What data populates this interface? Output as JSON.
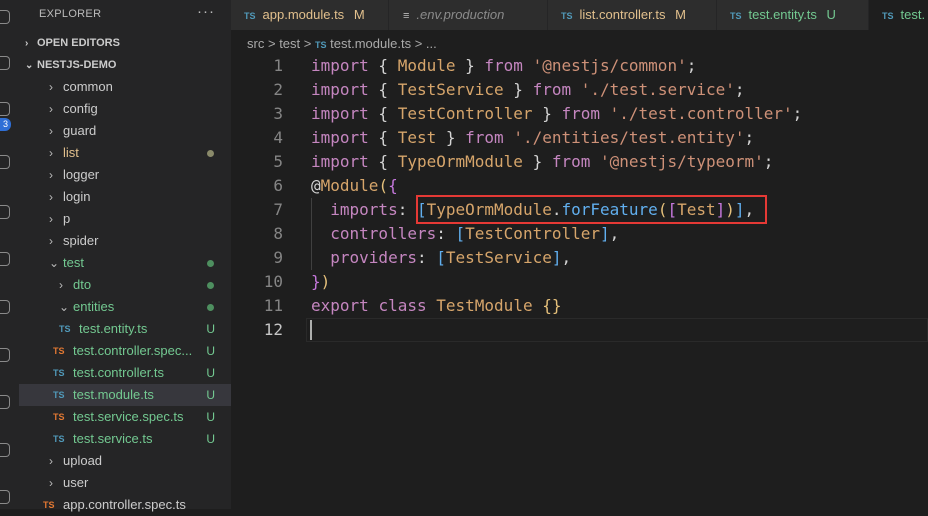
{
  "colors": {
    "ts_blue": "#519aba",
    "ts_orange": "#e37933",
    "untracked_green": "#73c991",
    "modified_yellow": "#e2c08d",
    "modified_dot": "#8a8a6a",
    "highlight_red": "#e53935"
  },
  "activity_bar": {
    "badge_count": "3",
    "icons": [
      "files-icon",
      "search-icon",
      "source-control-icon",
      "run-debug-icon",
      "extensions-icon",
      "remote-icon",
      "docker-icon",
      "accounts-icon"
    ]
  },
  "explorer": {
    "title": "EXPLORER",
    "more": "···",
    "open_editors": "OPEN EDITORS",
    "project": "NESTJS-DEMO",
    "tree": [
      {
        "label": "common",
        "kind": "folder",
        "depth": 1,
        "status": ""
      },
      {
        "label": "config",
        "kind": "folder",
        "depth": 1,
        "status": ""
      },
      {
        "label": "guard",
        "kind": "folder",
        "depth": 1,
        "status": ""
      },
      {
        "label": "list",
        "kind": "folder",
        "depth": 1,
        "status": "dot-modified"
      },
      {
        "label": "logger",
        "kind": "folder",
        "depth": 1,
        "status": ""
      },
      {
        "label": "login",
        "kind": "folder",
        "depth": 1,
        "status": ""
      },
      {
        "label": "p",
        "kind": "folder",
        "depth": 1,
        "status": ""
      },
      {
        "label": "spider",
        "kind": "folder",
        "depth": 1,
        "status": ""
      },
      {
        "label": "test",
        "kind": "folder-open",
        "depth": 1,
        "status": "dot-untracked"
      },
      {
        "label": "dto",
        "kind": "folder",
        "depth": 2,
        "status": "dot-untracked"
      },
      {
        "label": "entities",
        "kind": "folder-open",
        "depth": 2,
        "status": "dot-untracked"
      },
      {
        "label": "test.entity.ts",
        "kind": "ts-blue",
        "depth": 3,
        "status": "U"
      },
      {
        "label": "test.controller.spec...",
        "kind": "ts-orange",
        "depth": 2,
        "status": "U"
      },
      {
        "label": "test.controller.ts",
        "kind": "ts-blue",
        "depth": 2,
        "status": "U"
      },
      {
        "label": "test.module.ts",
        "kind": "ts-blue",
        "depth": 2,
        "status": "U",
        "selected": true
      },
      {
        "label": "test.service.spec.ts",
        "kind": "ts-orange",
        "depth": 2,
        "status": "U"
      },
      {
        "label": "test.service.ts",
        "kind": "ts-blue",
        "depth": 2,
        "status": "U"
      },
      {
        "label": "upload",
        "kind": "folder",
        "depth": 1,
        "status": ""
      },
      {
        "label": "user",
        "kind": "folder",
        "depth": 1,
        "status": ""
      },
      {
        "label": "app.controller.spec.ts",
        "kind": "ts-orange",
        "depth": 1,
        "status": ""
      }
    ]
  },
  "tabs": [
    {
      "icon": "TS",
      "label": "app.module.ts",
      "status": "M",
      "color": "#e2c08d"
    },
    {
      "icon": "≡",
      "label": ".env.production",
      "status": "",
      "color": "#8b8b8b"
    },
    {
      "icon": "TS",
      "label": "list.controller.ts",
      "status": "M",
      "color": "#e2c08d"
    },
    {
      "icon": "TS",
      "label": "test.entity.ts",
      "status": "U",
      "color": "#73c991"
    },
    {
      "icon": "TS",
      "label": "test.",
      "status": "",
      "color": "#73c991"
    }
  ],
  "breadcrumb": {
    "src": "src",
    "folder": "test",
    "sep": ">",
    "ts": "TS",
    "file": "test.module.ts",
    "more": "..."
  },
  "editor": {
    "line_numbers": [
      "1",
      "2",
      "3",
      "4",
      "5",
      "6",
      "7",
      "8",
      "9",
      "10",
      "11",
      "12"
    ],
    "current_line": "12"
  }
}
